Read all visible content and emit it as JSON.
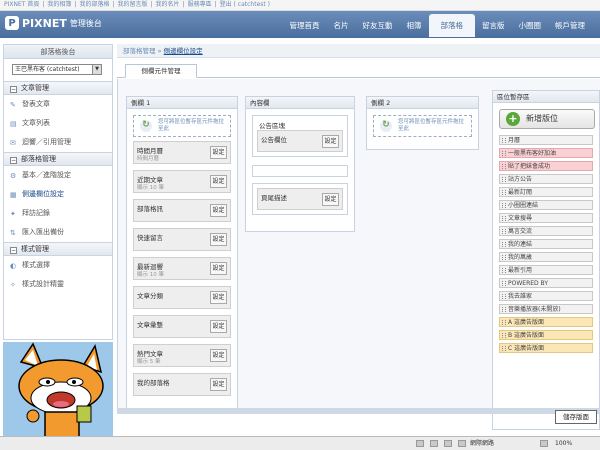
{
  "topbar": {
    "links": [
      "PIXNET 首頁",
      "|",
      "我的相簿",
      "|",
      "我的部落格",
      "|",
      "我的留言版",
      "|",
      "我的名片",
      "|",
      "服務專區",
      "|",
      "登出 ( catchtest )"
    ]
  },
  "header": {
    "logo_text": "PIXNET",
    "logo_sub": "管理後台",
    "tabs": [
      "管理首頁",
      "名片",
      "好友互動",
      "相簿",
      "部落格",
      "留言版",
      "小圈圈",
      "帳戶管理"
    ],
    "active_tab": "部落格"
  },
  "sidebar": {
    "title": "部落格後台",
    "select_value": "王巴黑布客 (catchtest)",
    "sections": [
      {
        "title": "文章管理",
        "items": [
          {
            "label": "發表文章",
            "icon": "pencil-icon"
          },
          {
            "label": "文章列表",
            "icon": "document-icon"
          },
          {
            "label": "迴響／引用管理",
            "icon": "comment-icon"
          }
        ]
      },
      {
        "title": "部落格管理",
        "items": [
          {
            "label": "基本／進階設定",
            "icon": "gear-icon"
          },
          {
            "label": "側邊欄位設定",
            "icon": "layout-icon"
          },
          {
            "label": "拜訪記錄",
            "icon": "footprint-icon"
          },
          {
            "label": "匯入匯出備份",
            "icon": "backup-icon"
          }
        ]
      },
      {
        "title": "樣式管理",
        "items": [
          {
            "label": "樣式選擇",
            "icon": "palette-icon"
          },
          {
            "label": "樣式設計精靈",
            "icon": "wand-icon"
          }
        ]
      }
    ]
  },
  "breadcrumb": {
    "parent": "部落格管理",
    "sep": "»",
    "current": "側邊欄位設定"
  },
  "subtab": {
    "label": "側欄元件管理"
  },
  "columns": {
    "side1": {
      "title": "側欄 1",
      "drop_text": "您可將區位暫存區元件拖拉至此",
      "blocks": [
        {
          "title": "時間月曆",
          "sub": "時間月曆"
        },
        {
          "title": "近期文章",
          "sub": "顯示 10 筆"
        },
        {
          "title": "部落格訊",
          "sub": ""
        },
        {
          "title": "快速留言",
          "sub": ""
        },
        {
          "title": "最新迴響",
          "sub": "顯示 10 筆"
        },
        {
          "title": "文章分類",
          "sub": ""
        },
        {
          "title": "文章彙整",
          "sub": ""
        },
        {
          "title": "熱門文章",
          "sub": "顯示 5 筆"
        },
        {
          "title": "我的部落格",
          "sub": ""
        }
      ]
    },
    "content": {
      "title": "內容欄",
      "group_label": "公告區塊",
      "block1": "公告欄位",
      "block2": "頁尾描述"
    },
    "side2": {
      "title": "側欄 2",
      "drop_text": "您可將區位暫存區元件拖拉至此"
    }
  },
  "setting_label": "設定",
  "pool": {
    "title": "區位暫存區",
    "add_label": "新增版位",
    "items": [
      {
        "label": "月曆",
        "style": "normal"
      },
      {
        "label": "一般黑布客好加油",
        "style": "red"
      },
      {
        "label": "貼了把妹會成功",
        "style": "red"
      },
      {
        "label": "站方公告",
        "style": "normal"
      },
      {
        "label": "最新訂閱",
        "style": "normal"
      },
      {
        "label": "小圈圈連結",
        "style": "normal"
      },
      {
        "label": "文章搜尋",
        "style": "normal"
      },
      {
        "label": "萬言交流",
        "style": "normal"
      },
      {
        "label": "我的連結",
        "style": "normal"
      },
      {
        "label": "我的萬歲",
        "style": "normal"
      },
      {
        "label": "最新引用",
        "style": "normal"
      },
      {
        "label": "POWERED BY",
        "style": "normal"
      },
      {
        "label": "我去誰家",
        "style": "normal"
      },
      {
        "label": "音樂播放器(未開放)",
        "style": "normal"
      },
      {
        "label": "A 這廣告版面",
        "style": "yellow"
      },
      {
        "label": "B 這廣告版面",
        "style": "yellow"
      },
      {
        "label": "C 這廣告版面",
        "style": "yellow"
      }
    ]
  },
  "save_label": "儲存版面",
  "status": {
    "zone": "網際網路",
    "zoom": "100%"
  }
}
